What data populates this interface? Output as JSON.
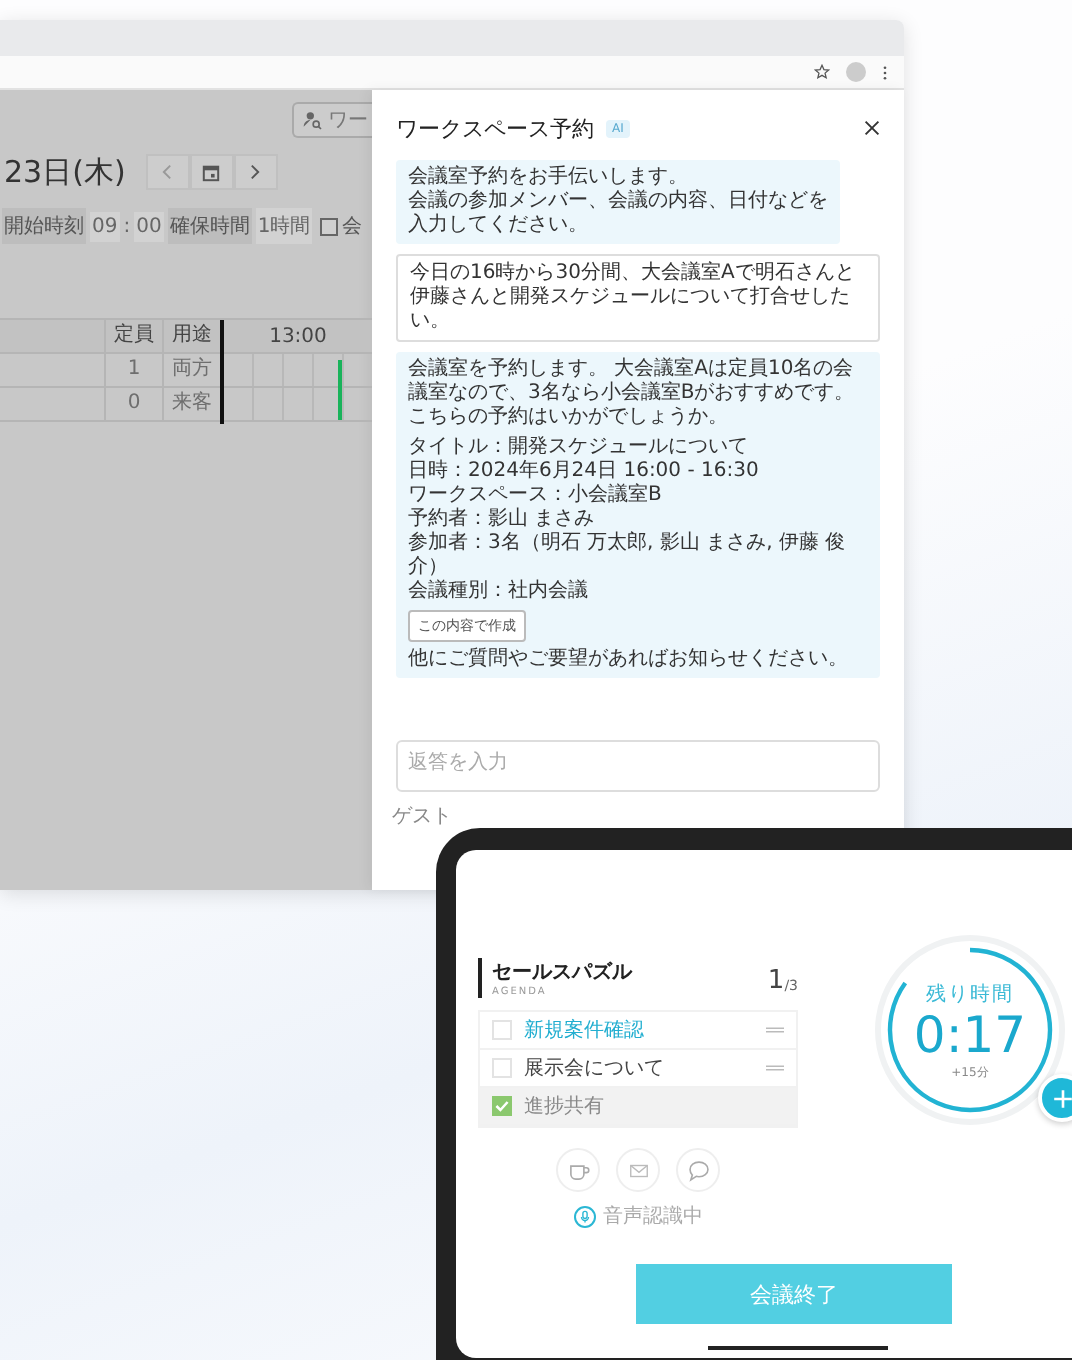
{
  "background_app": {
    "top_button": "ワー",
    "date": "23日(木)",
    "start_time": {
      "label": "開始時刻",
      "hour": "09",
      "separator": ":",
      "minute": "00"
    },
    "duration": {
      "label": "確保時間",
      "value": "1時間"
    },
    "filter_checkbox": {
      "label": "会",
      "checked": false
    },
    "table": {
      "columns": [
        "定員",
        "用途"
      ],
      "timeline_label": "13:00",
      "rows": [
        {
          "capacity": "1",
          "purpose": "両方"
        },
        {
          "capacity": "0",
          "purpose": "来客"
        }
      ]
    }
  },
  "assistant_panel": {
    "title": "ワークスペース予約",
    "badge": "AI",
    "messages": [
      {
        "kind": "bot",
        "lines": [
          "会議室予約をお手伝いします。",
          "会議の参加メンバー、会議の内容、日付などを入力してください。"
        ]
      },
      {
        "kind": "user",
        "lines": [
          "今日の16時から30分間、大会議室Aで明石さんと伊藤さんと開発スケジュールについて打合せしたい。"
        ]
      },
      {
        "kind": "proposal",
        "intro": "会議室を予約します。 大会議室Aは定員10名の会議室なので、3名なら小会議室Bがおすすめです。こちらの予約はいかがでしょうか。",
        "details": [
          "タイトル：開発スケジュールについて",
          "日時：2024年6月24日 16:00 - 16:30",
          "ワークスペース：小会議室B",
          "予約者：影山 まさみ",
          "参加者：3名（明石 万太郎, 影山 まさみ, 伊藤 俊介）",
          "会議種別：社内会議"
        ],
        "button": "この内容で作成",
        "closing": "他にご質問やご要望があればお知らせください。"
      }
    ],
    "input": {
      "placeholder": "返答を入力"
    },
    "note": "ゲスト"
  },
  "tablet": {
    "title": "セールスパズル",
    "subtitle": "AGENDA",
    "page": "1",
    "page_total": "/3",
    "agenda": [
      {
        "label": "新規案件確認",
        "selected": true,
        "checked": false
      },
      {
        "label": "展示会について",
        "selected": false,
        "checked": false
      },
      {
        "label": "進捗共有",
        "selected": false,
        "checked": true
      }
    ],
    "voice_status": "音声認識中",
    "timer": {
      "label": "残り時間",
      "value": "0:17",
      "extension": "+15分",
      "level": 0.85
    },
    "end_button": "会議終了"
  }
}
